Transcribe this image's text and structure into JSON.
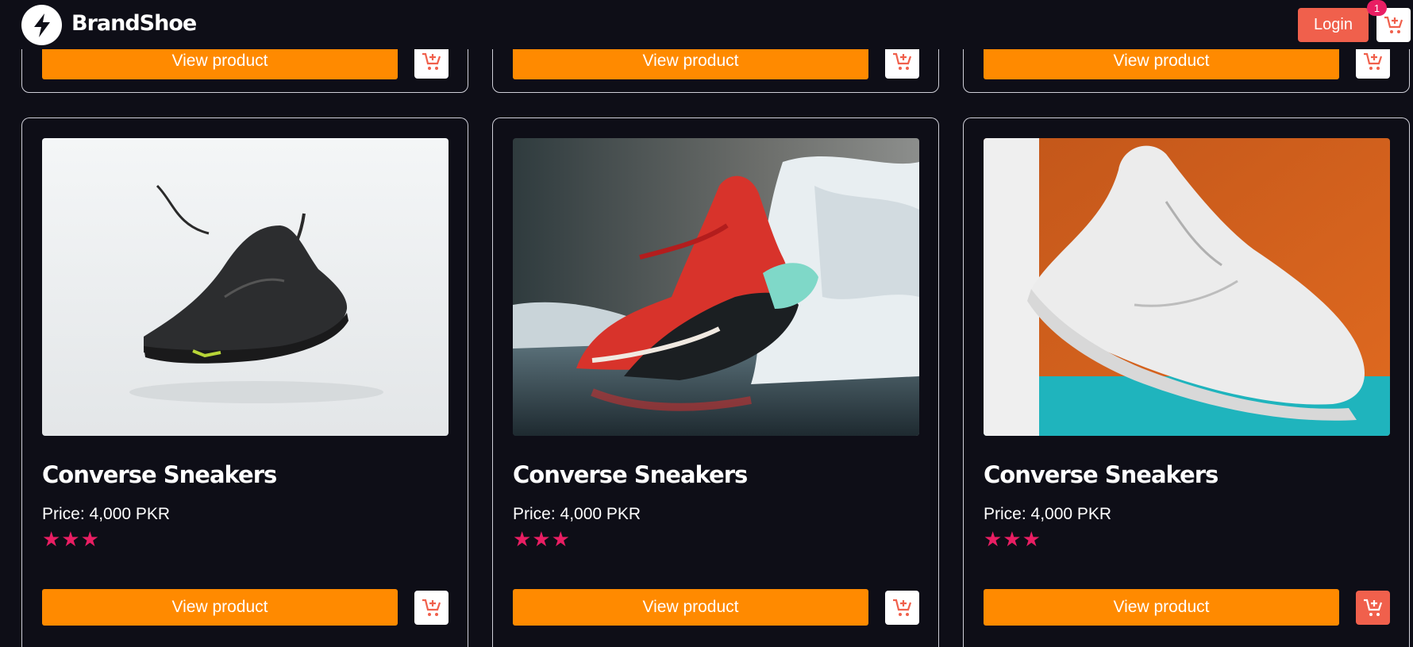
{
  "header": {
    "brand": "BrandShoe",
    "logo_icon": "lightning-bolt-icon",
    "login_label": "Login",
    "cart_icon": "cart-plus-icon",
    "cart_count": "1"
  },
  "colors": {
    "background": "#0e0e17",
    "accent_orange": "#ff8a00",
    "accent_coral": "#f0604c",
    "star_pink": "#e91e63"
  },
  "top_row": [
    {
      "button_label": "View product"
    },
    {
      "button_label": "View product"
    },
    {
      "button_label": "View product"
    }
  ],
  "products": [
    {
      "name": "Converse Sneakers",
      "price": "Price: 4,000 PKR",
      "rating": 3,
      "stars": "★★★",
      "button_label": "View product",
      "image": "black-running-shoe-on-white",
      "cart_active": false
    },
    {
      "name": "Converse Sneakers",
      "price": "Price: 4,000 PKR",
      "rating": 3,
      "stars": "★★★",
      "button_label": "View product",
      "image": "red-black-sneaker-in-snow",
      "cart_active": false
    },
    {
      "name": "Converse Sneakers",
      "price": "Price: 4,000 PKR",
      "rating": 3,
      "stars": "★★★",
      "button_label": "View product",
      "image": "white-sneaker-orange-background",
      "cart_active": true
    }
  ]
}
